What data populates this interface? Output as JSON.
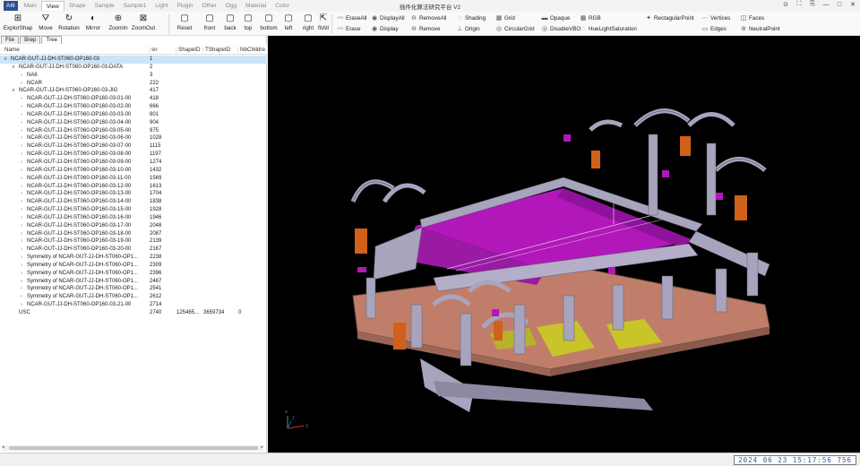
{
  "app": {
    "menu_button": "AI6",
    "window_title": "插件化算法研究平台 V2"
  },
  "menu_tabs": [
    "Main",
    "View",
    "Shape",
    "Sample",
    "Sample1",
    "Light",
    "Plugin",
    "Other",
    "Ogg",
    "Material",
    "Color"
  ],
  "window_controls": [
    "⊙",
    "⛶",
    "⎘",
    "—",
    "□",
    "✕"
  ],
  "toolbar": {
    "big": [
      {
        "label": "ExplorShap",
        "icon": "⊞"
      },
      {
        "label": "Move",
        "icon": "⛛"
      },
      {
        "label": "Rotation",
        "icon": "↻"
      },
      {
        "label": "Mirror",
        "icon": "◐"
      },
      {
        "label": "ZoomIn",
        "icon": "⊕"
      },
      {
        "label": "ZoomOut",
        "icon": "⊠"
      },
      {
        "label": "Reset",
        "icon": "▢"
      },
      {
        "label": "front",
        "icon": "▢"
      },
      {
        "label": "back",
        "icon": "▢"
      },
      {
        "label": "top",
        "icon": "▢"
      },
      {
        "label": "bottom",
        "icon": "▢"
      },
      {
        "label": "left",
        "icon": "▢"
      },
      {
        "label": "right",
        "icon": "▢"
      },
      {
        "label": "fitAll",
        "icon": "⇱"
      }
    ],
    "small": [
      {
        "label": "EraseAll",
        "icon": "〰"
      },
      {
        "label": "Erase",
        "icon": "〰"
      },
      {
        "label": "DisplayAll",
        "icon": "◉"
      },
      {
        "label": "Display",
        "icon": "◉"
      },
      {
        "label": "RemoveAll",
        "icon": "⊖"
      },
      {
        "label": "Remove",
        "icon": "⊖"
      },
      {
        "label": "Shading",
        "icon": "◌"
      },
      {
        "label": "Origin",
        "icon": "⊥"
      },
      {
        "label": "Grid",
        "icon": "▦"
      },
      {
        "label": "CircularGrid",
        "icon": "◎"
      },
      {
        "label": "Opaque",
        "icon": "▬"
      },
      {
        "label": "DisableVBO",
        "icon": "◎"
      },
      {
        "label": "RGB",
        "icon": "▦"
      },
      {
        "label": "HueLightSaturation",
        "icon": "◌"
      },
      {
        "label": "RectagularPoint",
        "icon": "✦"
      },
      {
        "label": "Vertices",
        "icon": "⋯"
      },
      {
        "label": "Edges",
        "icon": "▭"
      },
      {
        "label": "Faces",
        "icon": "◫"
      },
      {
        "label": "NeutralPoint",
        "icon": "⊚"
      }
    ]
  },
  "panel": {
    "tabs": [
      "File",
      "Brep",
      "Tree"
    ],
    "columns": [
      "Name",
      "sn",
      "ShapeID",
      "TShapeID",
      "NbChildre"
    ],
    "rows": [
      {
        "level": 0,
        "arrow": "∨",
        "name": "NCAR-GUT-JJ-DH-ST060-OP160-03",
        "sn": "1",
        "shape": "",
        "tshape": "",
        "nb": "",
        "sel": true
      },
      {
        "level": 1,
        "arrow": "∨",
        "name": "NCAR-GUT-JJ-DH-ST060-OP160-03-DATA",
        "sn": "2",
        "shape": "",
        "tshape": "",
        "nb": ""
      },
      {
        "level": 2,
        "arrow": "›",
        "name": "NA6",
        "sn": "3",
        "shape": "",
        "tshape": "",
        "nb": ""
      },
      {
        "level": 2,
        "arrow": "›",
        "name": "NCAR",
        "sn": "222",
        "shape": "",
        "tshape": "",
        "nb": ""
      },
      {
        "level": 1,
        "arrow": "∨",
        "name": "NCAR-GUT-JJ-DH-ST060-OP160-03-JIG",
        "sn": "417",
        "shape": "",
        "tshape": "",
        "nb": ""
      },
      {
        "level": 2,
        "arrow": "›",
        "name": "NCAR-GUT-JJ-DH-ST060-OP160-03-01-00",
        "sn": "418",
        "shape": "",
        "tshape": "",
        "nb": ""
      },
      {
        "level": 2,
        "arrow": "›",
        "name": "NCAR-GUT-JJ-DH-ST060-OP160-03-02-00",
        "sn": "666",
        "shape": "",
        "tshape": "",
        "nb": ""
      },
      {
        "level": 2,
        "arrow": "›",
        "name": "NCAR-GUT-JJ-DH-ST060-OP160-03-03-00",
        "sn": "801",
        "shape": "",
        "tshape": "",
        "nb": ""
      },
      {
        "level": 2,
        "arrow": "›",
        "name": "NCAR-GUT-JJ-DH-ST060-OP160-03-04-00",
        "sn": "904",
        "shape": "",
        "tshape": "",
        "nb": ""
      },
      {
        "level": 2,
        "arrow": "›",
        "name": "NCAR-GUT-JJ-DH-ST060-OP160-03-05-00",
        "sn": "975",
        "shape": "",
        "tshape": "",
        "nb": ""
      },
      {
        "level": 2,
        "arrow": "›",
        "name": "NCAR-GUT-JJ-DH-ST060-OP160-03-06-00",
        "sn": "1028",
        "shape": "",
        "tshape": "",
        "nb": ""
      },
      {
        "level": 2,
        "arrow": "›",
        "name": "NCAR-GUT-JJ-DH-ST060-OP160-03-07-00",
        "sn": "1115",
        "shape": "",
        "tshape": "",
        "nb": ""
      },
      {
        "level": 2,
        "arrow": "›",
        "name": "NCAR-GUT-JJ-DH-ST060-OP160-03-08-00",
        "sn": "1197",
        "shape": "",
        "tshape": "",
        "nb": ""
      },
      {
        "level": 2,
        "arrow": "›",
        "name": "NCAR-GUT-JJ-DH-ST060-OP160-03-09-00",
        "sn": "1274",
        "shape": "",
        "tshape": "",
        "nb": ""
      },
      {
        "level": 2,
        "arrow": "›",
        "name": "NCAR-GUT-JJ-DH-ST060-OP160-03-10-00",
        "sn": "1432",
        "shape": "",
        "tshape": "",
        "nb": ""
      },
      {
        "level": 2,
        "arrow": "›",
        "name": "NCAR-GUT-JJ-DH-ST060-OP160-03-11-00",
        "sn": "1569",
        "shape": "",
        "tshape": "",
        "nb": ""
      },
      {
        "level": 2,
        "arrow": "›",
        "name": "NCAR-GUT-JJ-DH-ST060-OP160-03-12-00",
        "sn": "1613",
        "shape": "",
        "tshape": "",
        "nb": ""
      },
      {
        "level": 2,
        "arrow": "›",
        "name": "NCAR-GUT-JJ-DH-ST060-OP160-03-13-00",
        "sn": "1704",
        "shape": "",
        "tshape": "",
        "nb": ""
      },
      {
        "level": 2,
        "arrow": "›",
        "name": "NCAR-GUT-JJ-DH-ST060-OP160-03-14-00",
        "sn": "1838",
        "shape": "",
        "tshape": "",
        "nb": ""
      },
      {
        "level": 2,
        "arrow": "›",
        "name": "NCAR-GUT-JJ-DH-ST060-OP160-03-15-00",
        "sn": "1928",
        "shape": "",
        "tshape": "",
        "nb": ""
      },
      {
        "level": 2,
        "arrow": "›",
        "name": "NCAR-GUT-JJ-DH-ST060-OP160-03-16-00",
        "sn": "1946",
        "shape": "",
        "tshape": "",
        "nb": ""
      },
      {
        "level": 2,
        "arrow": "›",
        "name": "NCAR-GUT-JJ-DH-ST060-OP160-03-17-00",
        "sn": "2048",
        "shape": "",
        "tshape": "",
        "nb": ""
      },
      {
        "level": 2,
        "arrow": "›",
        "name": "NCAR-GUT-JJ-DH-ST060-OP160-03-18-00",
        "sn": "2087",
        "shape": "",
        "tshape": "",
        "nb": ""
      },
      {
        "level": 2,
        "arrow": "›",
        "name": "NCAR-GUT-JJ-DH-ST060-OP160-03-19-00",
        "sn": "2139",
        "shape": "",
        "tshape": "",
        "nb": ""
      },
      {
        "level": 2,
        "arrow": "›",
        "name": "NCAR-GUT-JJ-DH-ST060-OP160-03-20-00",
        "sn": "2167",
        "shape": "",
        "tshape": "",
        "nb": ""
      },
      {
        "level": 2,
        "arrow": "›",
        "name": "Symmetry of NCAR-GUT-JJ-DH-ST060-OP1...",
        "sn": "2238",
        "shape": "",
        "tshape": "",
        "nb": ""
      },
      {
        "level": 2,
        "arrow": "›",
        "name": "Symmetry of NCAR-GUT-JJ-DH-ST060-OP1...",
        "sn": "2309",
        "shape": "",
        "tshape": "",
        "nb": ""
      },
      {
        "level": 2,
        "arrow": "›",
        "name": "Symmetry of NCAR-GUT-JJ-DH-ST060-OP1...",
        "sn": "2396",
        "shape": "",
        "tshape": "",
        "nb": ""
      },
      {
        "level": 2,
        "arrow": "›",
        "name": "Symmetry of NCAR-GUT-JJ-DH-ST060-OP1...",
        "sn": "2467",
        "shape": "",
        "tshape": "",
        "nb": ""
      },
      {
        "level": 2,
        "arrow": "›",
        "name": "Symmetry of NCAR-GUT-JJ-DH-ST060-OP1...",
        "sn": "2541",
        "shape": "",
        "tshape": "",
        "nb": ""
      },
      {
        "level": 2,
        "arrow": "›",
        "name": "Symmetry of NCAR-GUT-JJ-DH-ST060-OP1...",
        "sn": "2612",
        "shape": "",
        "tshape": "",
        "nb": ""
      },
      {
        "level": 2,
        "arrow": "›",
        "name": "NCAR-GUT-JJ-DH-ST060-OP160-03-21-00",
        "sn": "2714",
        "shape": "",
        "tshape": "",
        "nb": ""
      },
      {
        "level": 1,
        "arrow": "",
        "name": "USC",
        "sn": "2740",
        "shape": "125465...",
        "tshape": "3659734",
        "nb": "0"
      }
    ]
  },
  "viewport": {
    "axis_x_label": "X",
    "axis_y_label": "Y",
    "axis_z_label": "Z"
  },
  "status": {
    "clock": "2024 06 23 15:17:56 756"
  },
  "colors": {
    "background": "#000000",
    "frame": "#a9a4bd",
    "surface": "#b117b9",
    "base": "#c07e6a",
    "pad": "#c9c42a",
    "accent": "#d0611b"
  }
}
